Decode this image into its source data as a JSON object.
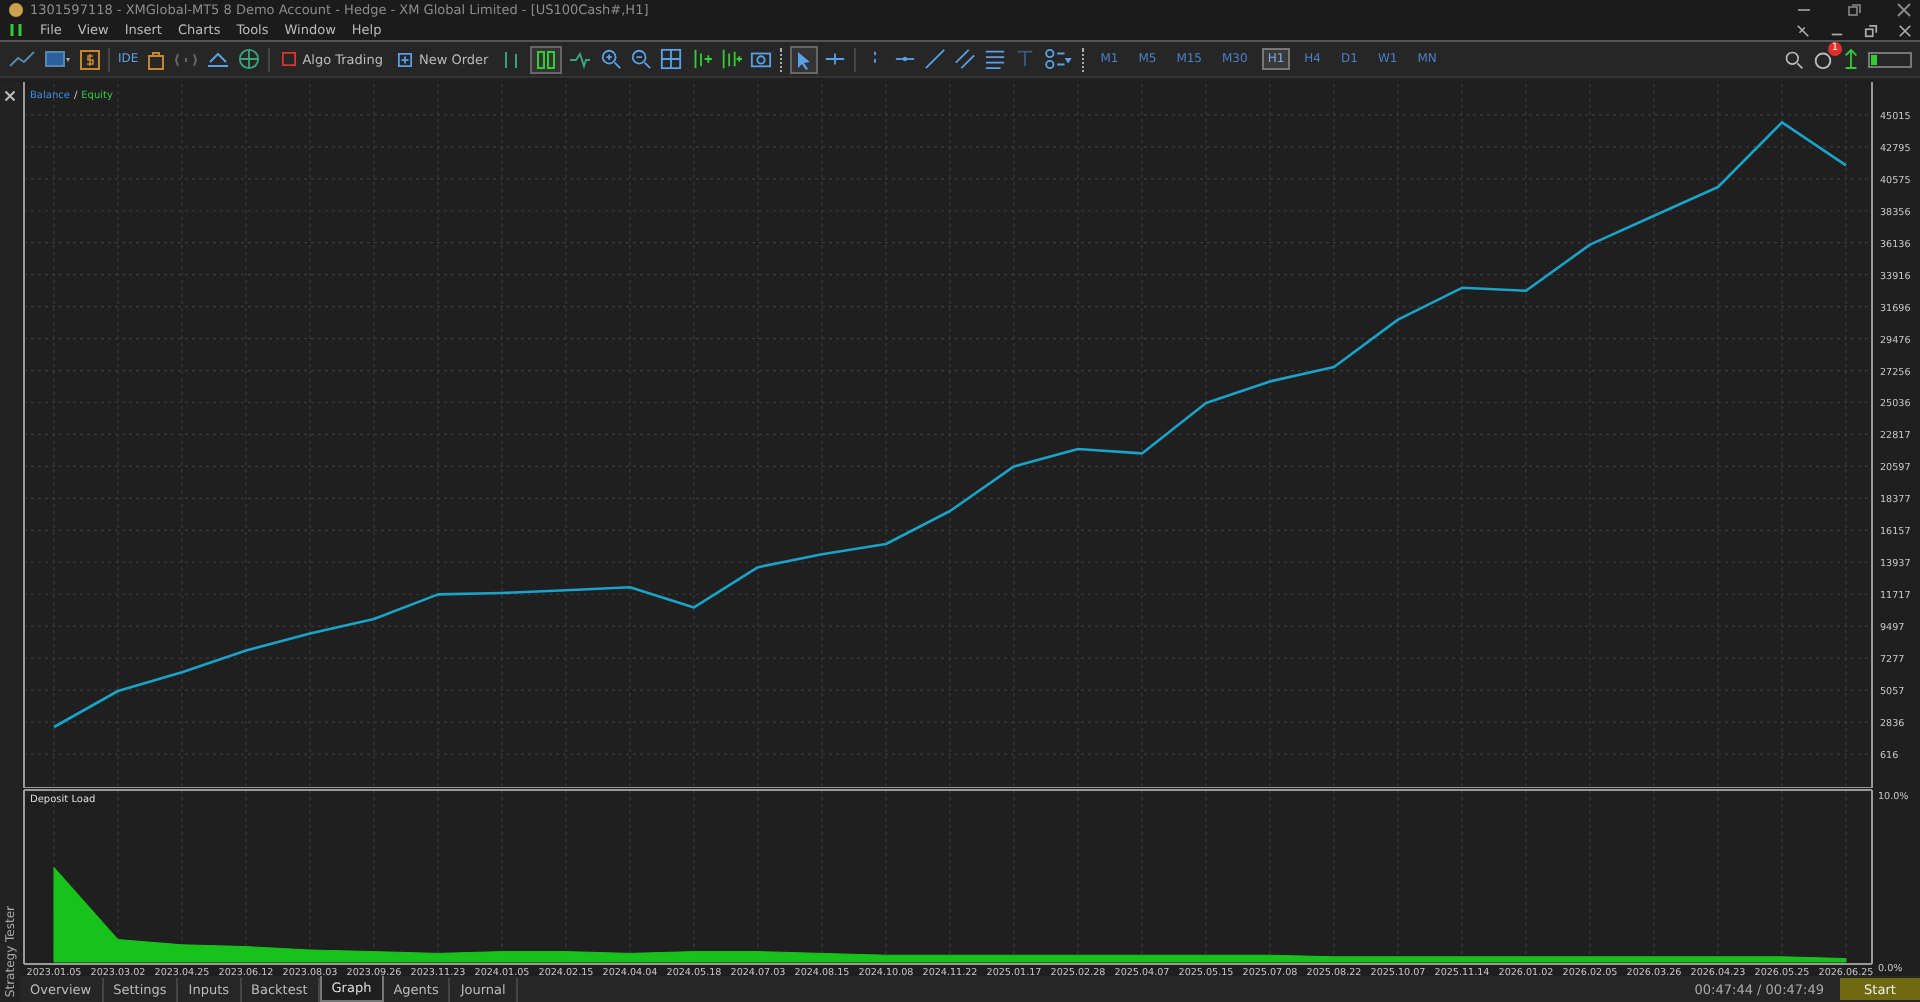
{
  "window": {
    "title": "1301597118 - XMGlobal-MT5 8 Demo Account - Hedge - XM Global Limited - [US100Cash#,H1]"
  },
  "menu": [
    "File",
    "View",
    "Insert",
    "Charts",
    "Tools",
    "Window",
    "Help"
  ],
  "toolbar": {
    "ide": "IDE",
    "algo_trading": "Algo Trading",
    "new_order": "New Order",
    "timeframes": [
      {
        "label": "M1",
        "selected": false
      },
      {
        "label": "M5",
        "selected": false
      },
      {
        "label": "M15",
        "selected": false
      },
      {
        "label": "M30",
        "selected": false
      },
      {
        "label": "H1",
        "selected": true
      },
      {
        "label": "H4",
        "selected": false
      },
      {
        "label": "D1",
        "selected": false
      },
      {
        "label": "W1",
        "selected": false
      },
      {
        "label": "MN",
        "selected": false
      }
    ],
    "notifications": "1"
  },
  "legend": {
    "separator": "/",
    "equity": "Equity"
  },
  "balance_chart": {
    "chart_data": {
      "type": "line",
      "grid": true,
      "series": [
        {
          "name": "Balance",
          "color": "#1aa3c8",
          "values": [
            2500,
            5000,
            6300,
            7800,
            9000,
            10000,
            11700,
            11800,
            12000,
            12200,
            10800,
            13600,
            14500,
            15200,
            17500,
            20600,
            21800,
            21500,
            25000,
            26500,
            27500,
            30800,
            33000,
            32800,
            36000,
            38000,
            40000,
            44500,
            41500
          ]
        }
      ],
      "ylim": [
        -1605,
        47300
      ],
      "yticks": [
        616,
        2836,
        5057,
        7277,
        9497,
        11717,
        13937,
        16157,
        18377,
        20597,
        22817,
        25036,
        27256,
        29476,
        31696,
        33916,
        36136,
        38356,
        40575,
        42795,
        45015
      ]
    }
  },
  "deposit_load": {
    "chart_data": {
      "type": "area",
      "grid": true,
      "categories": [
        "2023.01.05",
        "2023.03.02",
        "2023.04.25",
        "2023.06.12",
        "2023.08.03",
        "2023.09.26",
        "2023.11.23",
        "2024.01.05",
        "2024.02.15",
        "2024.04.04",
        "2024.05.18",
        "2024.07.03",
        "2024.08.15",
        "2024.10.08",
        "2024.11.22",
        "2025.01.17",
        "2025.02.28",
        "2025.04.07",
        "2025.05.15",
        "2025.07.08",
        "2025.08.22",
        "2025.10.07",
        "2025.11.14",
        "2026.01.02",
        "2026.02.05",
        "2026.03.26",
        "2026.04.23",
        "2026.05.25",
        "2026.06.25"
      ],
      "series": [
        {
          "name": "Deposit Load",
          "color": "#19c21b",
          "values": [
            5.5,
            1.3,
            1.0,
            0.9,
            0.7,
            0.6,
            0.5,
            0.6,
            0.6,
            0.5,
            0.6,
            0.6,
            0.5,
            0.4,
            0.4,
            0.4,
            0.4,
            0.4,
            0.4,
            0.4,
            0.3,
            0.3,
            0.3,
            0.3,
            0.3,
            0.3,
            0.3,
            0.3,
            0.2
          ]
        }
      ],
      "ylim": [
        0,
        10
      ],
      "yticks": [
        {
          "value": 0,
          "label": "0.0%"
        },
        {
          "value": 10,
          "label": "10.0%"
        }
      ]
    }
  },
  "side_panel": "Strategy Tester",
  "tabs": [
    {
      "label": "Overview",
      "selected": false
    },
    {
      "label": "Settings",
      "selected": false
    },
    {
      "label": "Inputs",
      "selected": false
    },
    {
      "label": "Backtest",
      "selected": false
    },
    {
      "label": "Graph",
      "selected": true
    },
    {
      "label": "Agents",
      "selected": false
    },
    {
      "label": "Journal",
      "selected": false
    }
  ],
  "elapsed": "00:47:44 / 00:47:49",
  "start_button": "Start"
}
